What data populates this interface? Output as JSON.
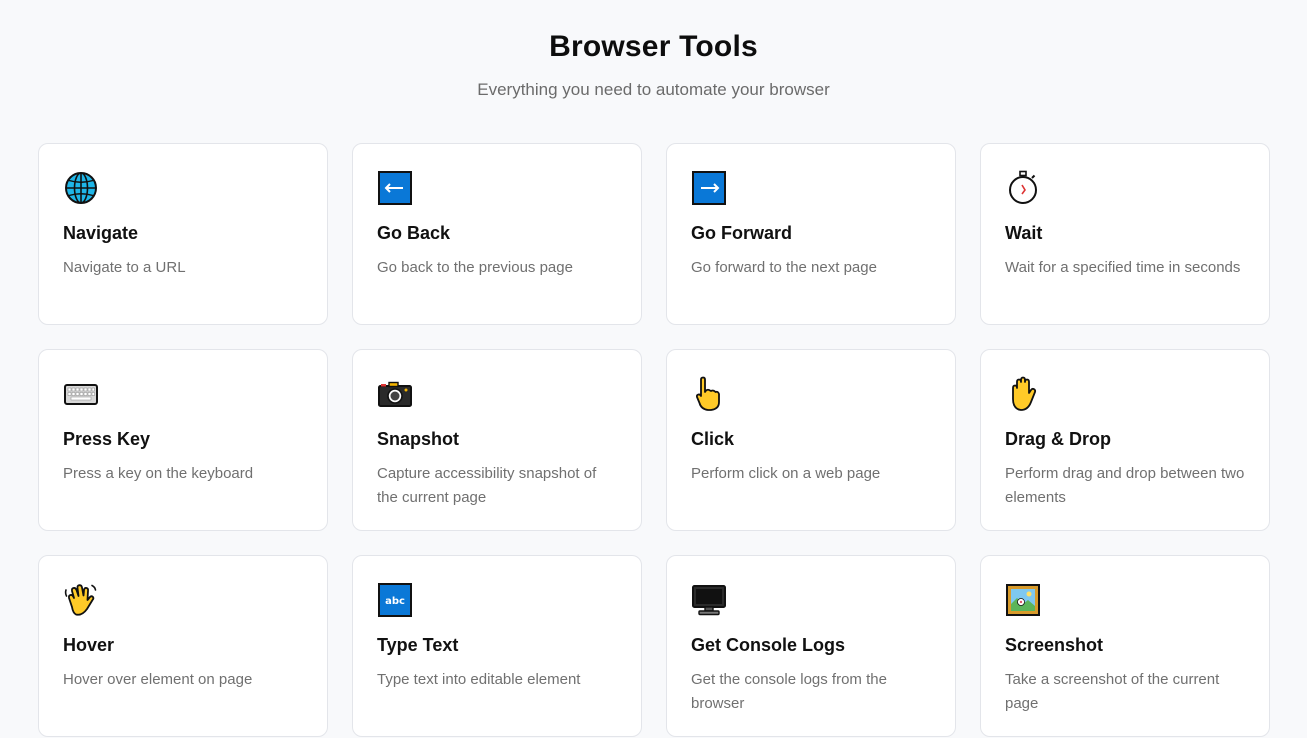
{
  "header": {
    "title": "Browser Tools",
    "subtitle": "Everything you need to automate your browser"
  },
  "tools": [
    {
      "icon": "globe-icon",
      "title": "Navigate",
      "description": "Navigate to a URL"
    },
    {
      "icon": "left-arrow-icon",
      "title": "Go Back",
      "description": "Go back to the previous page"
    },
    {
      "icon": "right-arrow-icon",
      "title": "Go Forward",
      "description": "Go forward to the next page"
    },
    {
      "icon": "stopwatch-icon",
      "title": "Wait",
      "description": "Wait for a specified time in seconds"
    },
    {
      "icon": "keyboard-icon",
      "title": "Press Key",
      "description": "Press a key on the keyboard"
    },
    {
      "icon": "camera-icon",
      "title": "Snapshot",
      "description": "Capture accessibility snapshot of the current page"
    },
    {
      "icon": "pointing-hand-icon",
      "title": "Click",
      "description": "Perform click on a web page"
    },
    {
      "icon": "raised-hand-icon",
      "title": "Drag & Drop",
      "description": "Perform drag and drop between two elements"
    },
    {
      "icon": "waving-hand-icon",
      "title": "Hover",
      "description": "Hover over element on page"
    },
    {
      "icon": "abc-input-icon",
      "title": "Type Text",
      "description": "Type text into editable element",
      "icon_text": "abc"
    },
    {
      "icon": "monitor-icon",
      "title": "Get Console Logs",
      "description": "Get the console logs from the browser"
    },
    {
      "icon": "framed-picture-icon",
      "title": "Screenshot",
      "description": "Take a screenshot of the current page"
    }
  ]
}
